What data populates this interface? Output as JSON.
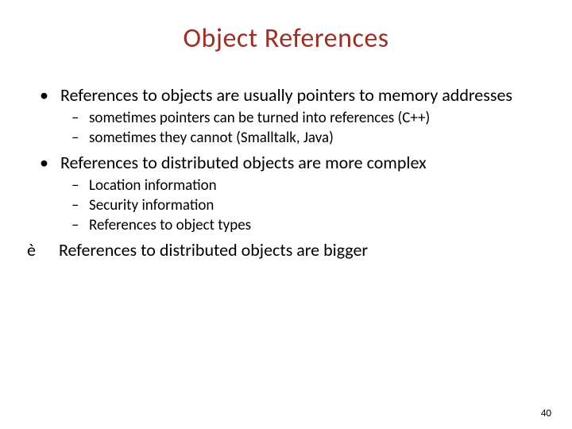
{
  "title": "Object References",
  "bullets": {
    "b1": "References to objects are usually pointers to memory addresses",
    "b1_1": "sometimes pointers can be turned into references (C++)",
    "b1_2": "sometimes they cannot (Smalltalk, Java)",
    "b2": "References to distributed objects are more complex",
    "b2_1": "Location information",
    "b2_2": "Security information",
    "b2_3": "References to object types",
    "b3_marker": "è",
    "b3": "References to distributed objects are bigger"
  },
  "page_number": "40"
}
